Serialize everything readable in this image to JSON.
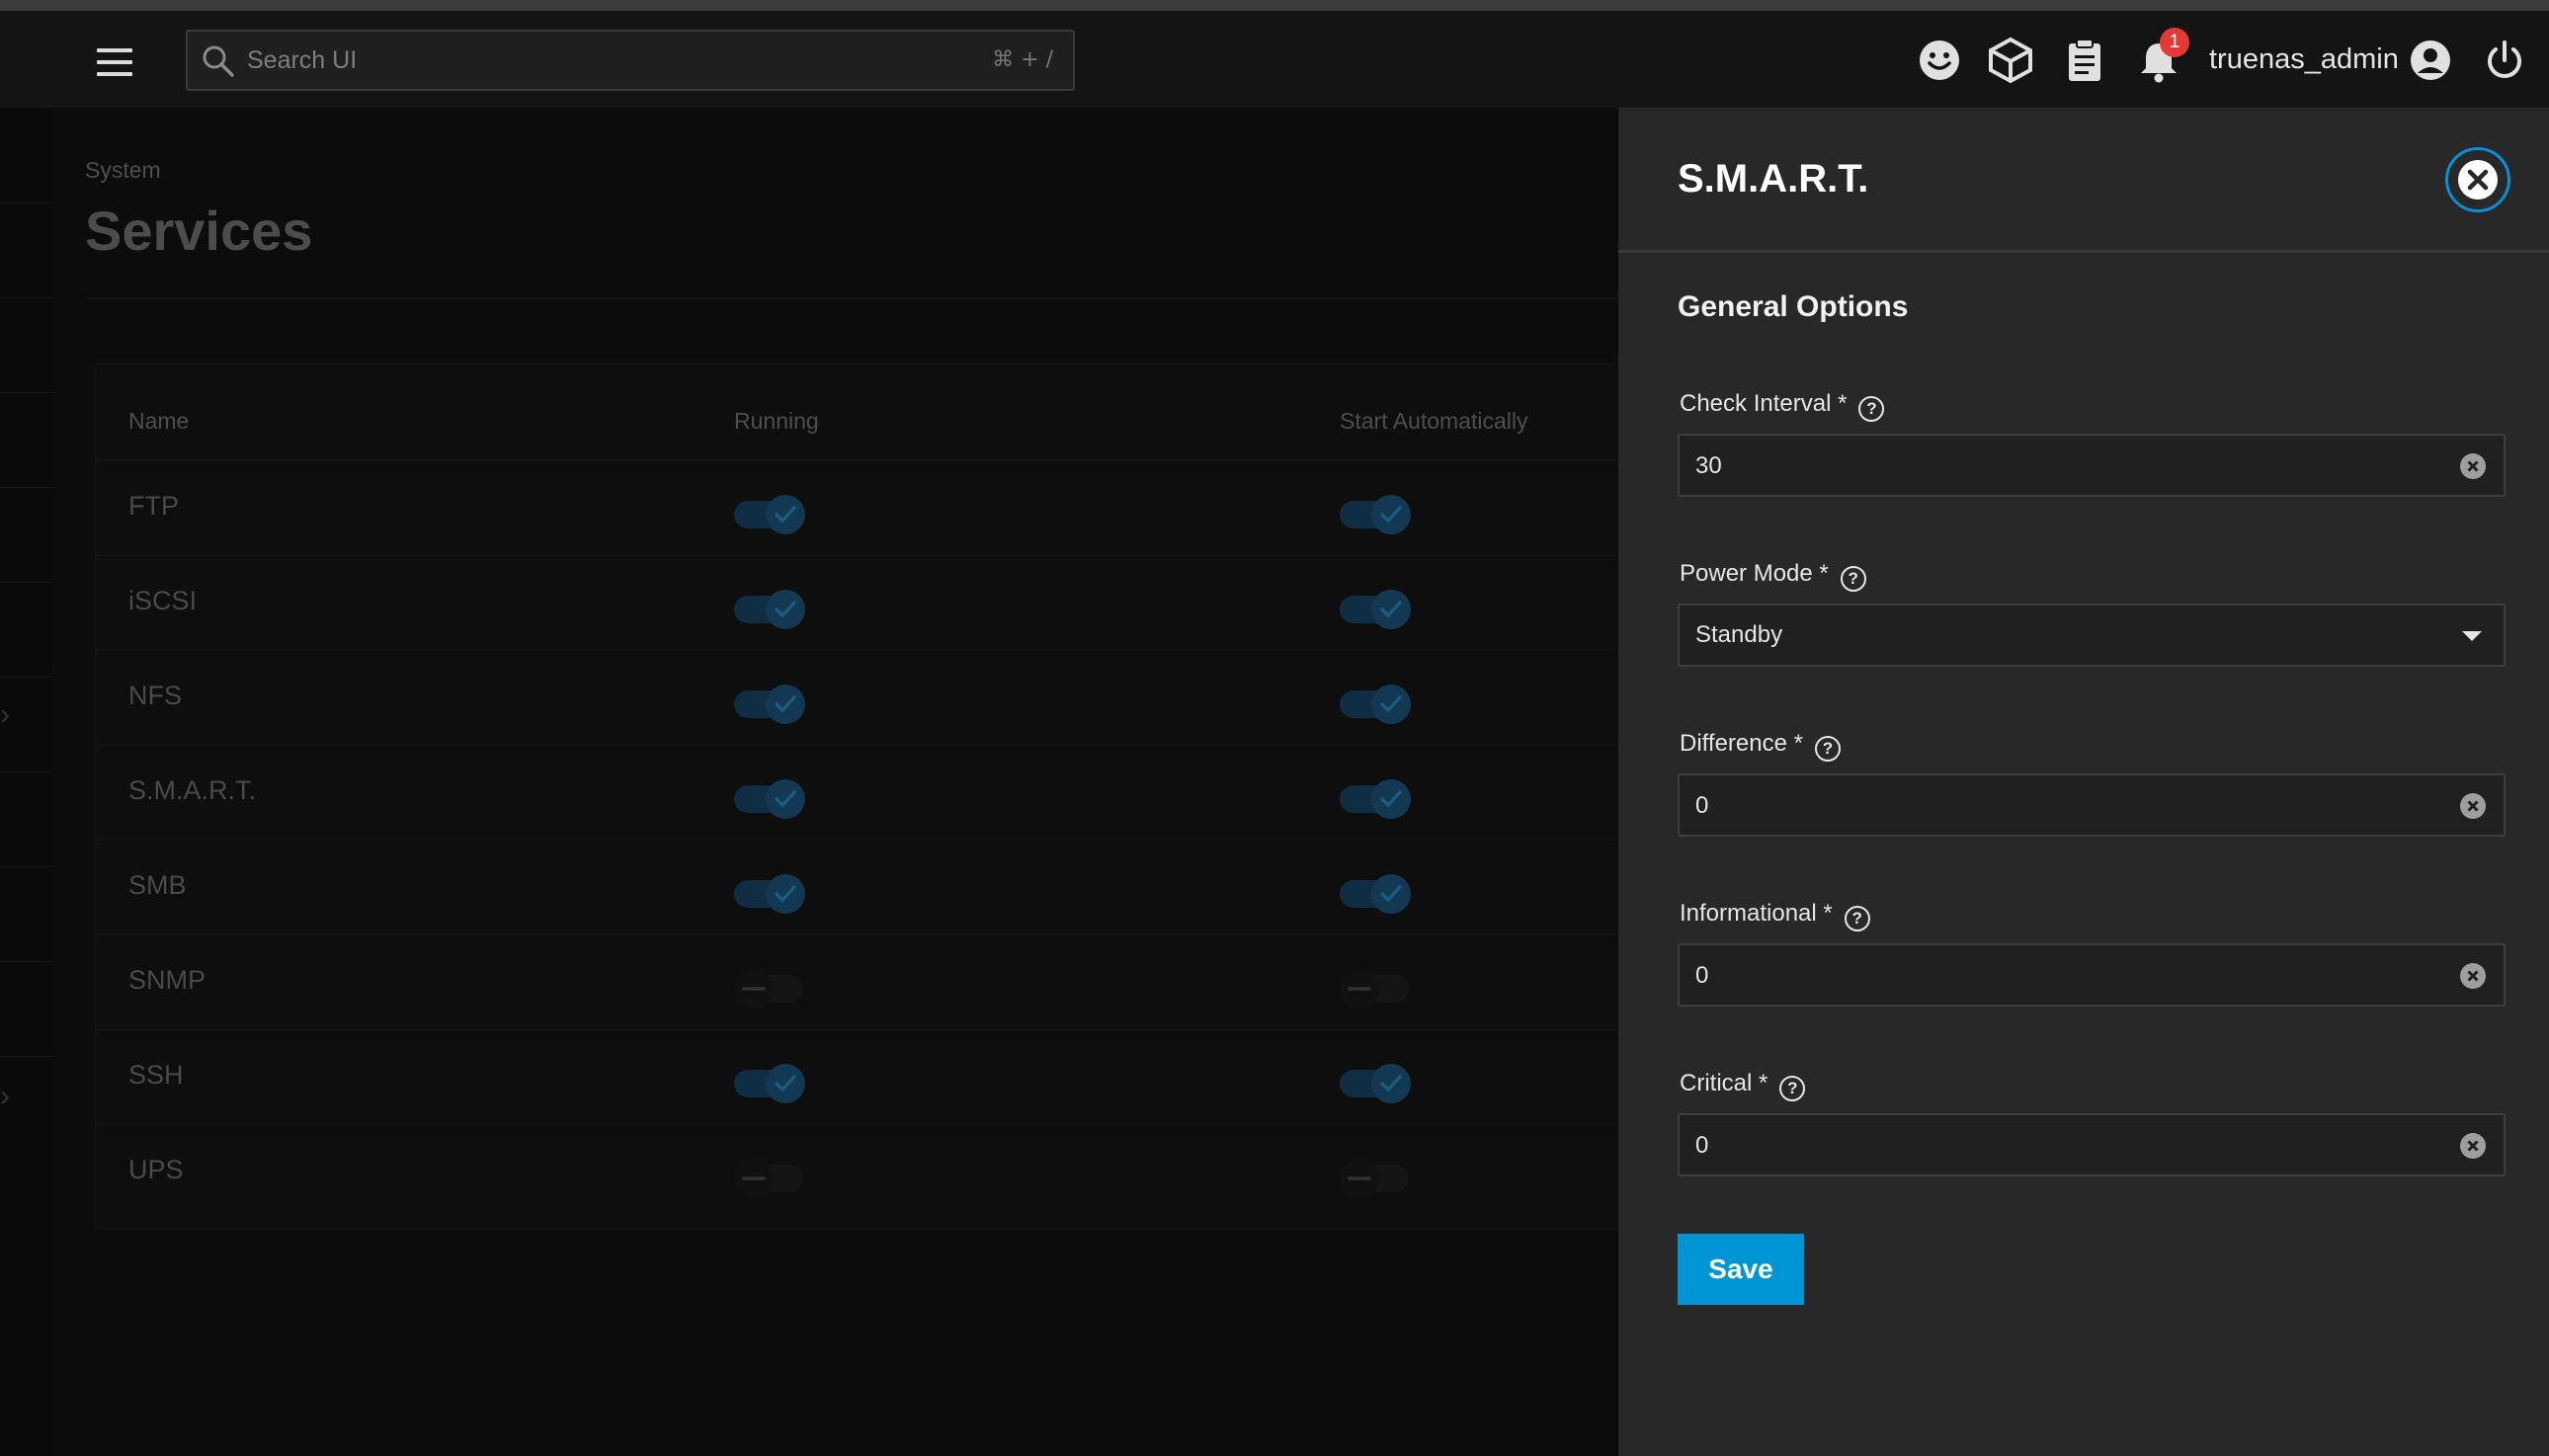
{
  "topbar": {
    "search_placeholder": "Search UI",
    "search_shortcut": "⌘ + /",
    "notification_count": "1",
    "username": "truenas_admin",
    "icons": [
      "menu-icon",
      "search-icon",
      "smile-icon",
      "truecommand-icon",
      "clipboard-icon",
      "bell-icon",
      "account-icon",
      "power-icon"
    ]
  },
  "page": {
    "breadcrumb": "System",
    "title": "Services"
  },
  "services_table": {
    "columns": [
      "Name",
      "Running",
      "Start Automatically"
    ],
    "rows": [
      {
        "name": "FTP",
        "running": true,
        "start_automatically": true
      },
      {
        "name": "iSCSI",
        "running": true,
        "start_automatically": true
      },
      {
        "name": "NFS",
        "running": true,
        "start_automatically": true
      },
      {
        "name": "S.M.A.R.T.",
        "running": true,
        "start_automatically": true
      },
      {
        "name": "SMB",
        "running": true,
        "start_automatically": true
      },
      {
        "name": "SNMP",
        "running": false,
        "start_automatically": false
      },
      {
        "name": "SSH",
        "running": true,
        "start_automatically": true
      },
      {
        "name": "UPS",
        "running": false,
        "start_automatically": false
      }
    ]
  },
  "panel": {
    "title": "S.M.A.R.T.",
    "section": "General Options",
    "fields": {
      "check_interval": {
        "label": "Check Interval *",
        "value": "30"
      },
      "power_mode": {
        "label": "Power Mode *",
        "value": "Standby"
      },
      "difference": {
        "label": "Difference *",
        "value": "0"
      },
      "informational": {
        "label": "Informational *",
        "value": "0"
      },
      "critical": {
        "label": "Critical *",
        "value": "0"
      }
    },
    "save_label": "Save"
  },
  "colors": {
    "accent": "#0095d5",
    "panel_bg": "#282828",
    "badge": "#e53935"
  }
}
